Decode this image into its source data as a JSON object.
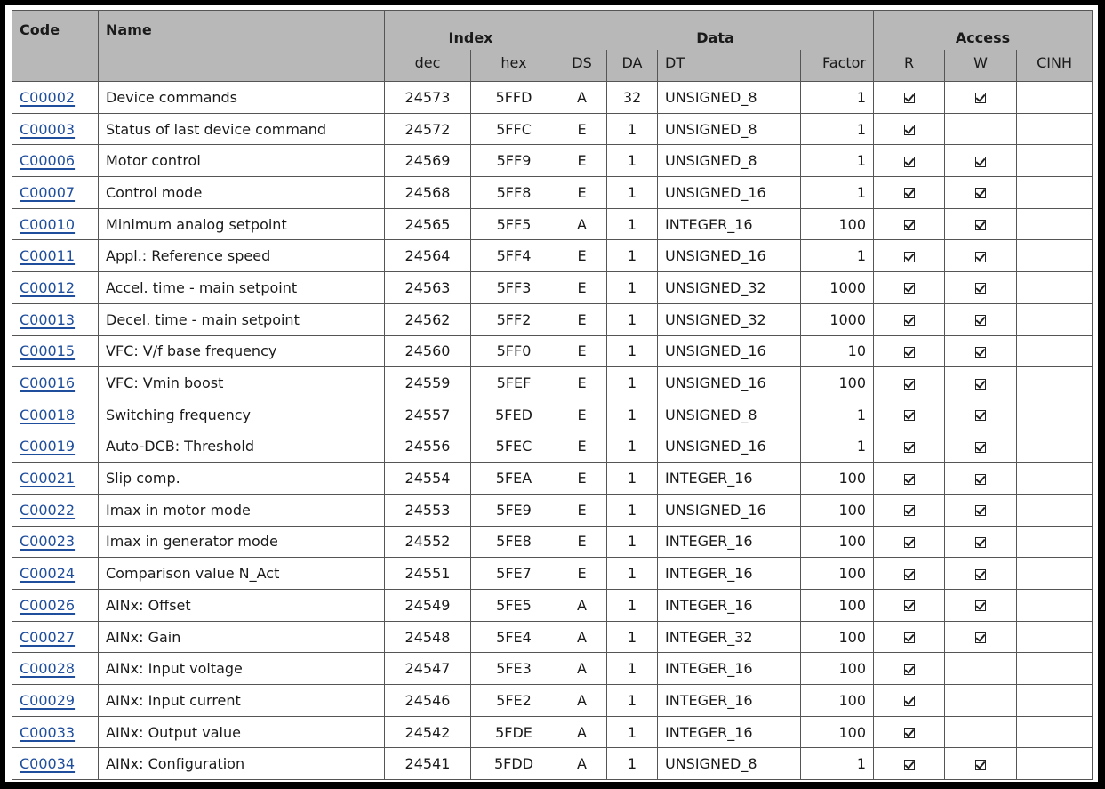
{
  "headers": {
    "code": "Code",
    "name": "Name",
    "index": "Index",
    "data": "Data",
    "access": "Access",
    "dec": "dec",
    "hex": "hex",
    "ds": "DS",
    "da": "DA",
    "dt": "DT",
    "factor": "Factor",
    "r": "R",
    "w": "W",
    "cinh": "CINH"
  },
  "icons": {
    "check": "checkbox-checked-icon"
  },
  "colors": {
    "header_bg": "#b8b8b8",
    "link": "#1f4e9c",
    "border": "#555555"
  },
  "rows": [
    {
      "code": "C00002",
      "name": "Device commands",
      "dec": "24573",
      "hex": "5FFD",
      "ds": "A",
      "da": "32",
      "dt": "UNSIGNED_8",
      "factor": "1",
      "r": true,
      "w": true,
      "cinh": false
    },
    {
      "code": "C00003",
      "name": "Status of last device command",
      "dec": "24572",
      "hex": "5FFC",
      "ds": "E",
      "da": "1",
      "dt": "UNSIGNED_8",
      "factor": "1",
      "r": true,
      "w": false,
      "cinh": false
    },
    {
      "code": "C00006",
      "name": "Motor control",
      "dec": "24569",
      "hex": "5FF9",
      "ds": "E",
      "da": "1",
      "dt": "UNSIGNED_8",
      "factor": "1",
      "r": true,
      "w": true,
      "cinh": false
    },
    {
      "code": "C00007",
      "name": "Control mode",
      "dec": "24568",
      "hex": "5FF8",
      "ds": "E",
      "da": "1",
      "dt": "UNSIGNED_16",
      "factor": "1",
      "r": true,
      "w": true,
      "cinh": false
    },
    {
      "code": "C00010",
      "name": "Minimum analog setpoint",
      "dec": "24565",
      "hex": "5FF5",
      "ds": "A",
      "da": "1",
      "dt": "INTEGER_16",
      "factor": "100",
      "r": true,
      "w": true,
      "cinh": false
    },
    {
      "code": "C00011",
      "name": "Appl.: Reference speed",
      "dec": "24564",
      "hex": "5FF4",
      "ds": "E",
      "da": "1",
      "dt": "UNSIGNED_16",
      "factor": "1",
      "r": true,
      "w": true,
      "cinh": false
    },
    {
      "code": "C00012",
      "name": "Accel. time - main setpoint",
      "dec": "24563",
      "hex": "5FF3",
      "ds": "E",
      "da": "1",
      "dt": "UNSIGNED_32",
      "factor": "1000",
      "r": true,
      "w": true,
      "cinh": false
    },
    {
      "code": "C00013",
      "name": "Decel. time - main setpoint",
      "dec": "24562",
      "hex": "5FF2",
      "ds": "E",
      "da": "1",
      "dt": "UNSIGNED_32",
      "factor": "1000",
      "r": true,
      "w": true,
      "cinh": false
    },
    {
      "code": "C00015",
      "name": "VFC: V/f base frequency",
      "dec": "24560",
      "hex": "5FF0",
      "ds": "E",
      "da": "1",
      "dt": "UNSIGNED_16",
      "factor": "10",
      "r": true,
      "w": true,
      "cinh": false
    },
    {
      "code": "C00016",
      "name": "VFC: Vmin boost",
      "dec": "24559",
      "hex": "5FEF",
      "ds": "E",
      "da": "1",
      "dt": "UNSIGNED_16",
      "factor": "100",
      "r": true,
      "w": true,
      "cinh": false
    },
    {
      "code": "C00018",
      "name": "Switching frequency",
      "dec": "24557",
      "hex": "5FED",
      "ds": "E",
      "da": "1",
      "dt": "UNSIGNED_8",
      "factor": "1",
      "r": true,
      "w": true,
      "cinh": false
    },
    {
      "code": "C00019",
      "name": "Auto-DCB: Threshold",
      "dec": "24556",
      "hex": "5FEC",
      "ds": "E",
      "da": "1",
      "dt": "UNSIGNED_16",
      "factor": "1",
      "r": true,
      "w": true,
      "cinh": false
    },
    {
      "code": "C00021",
      "name": "Slip comp.",
      "dec": "24554",
      "hex": "5FEA",
      "ds": "E",
      "da": "1",
      "dt": "INTEGER_16",
      "factor": "100",
      "r": true,
      "w": true,
      "cinh": false
    },
    {
      "code": "C00022",
      "name": "Imax in motor mode",
      "dec": "24553",
      "hex": "5FE9",
      "ds": "E",
      "da": "1",
      "dt": "UNSIGNED_16",
      "factor": "100",
      "r": true,
      "w": true,
      "cinh": false
    },
    {
      "code": "C00023",
      "name": "Imax in generator mode",
      "dec": "24552",
      "hex": "5FE8",
      "ds": "E",
      "da": "1",
      "dt": "INTEGER_16",
      "factor": "100",
      "r": true,
      "w": true,
      "cinh": false
    },
    {
      "code": "C00024",
      "name": "Comparison value N_Act",
      "dec": "24551",
      "hex": "5FE7",
      "ds": "E",
      "da": "1",
      "dt": "INTEGER_16",
      "factor": "100",
      "r": true,
      "w": true,
      "cinh": false
    },
    {
      "code": "C00026",
      "name": "AINx: Offset",
      "dec": "24549",
      "hex": "5FE5",
      "ds": "A",
      "da": "1",
      "dt": "INTEGER_16",
      "factor": "100",
      "r": true,
      "w": true,
      "cinh": false
    },
    {
      "code": "C00027",
      "name": "AINx: Gain",
      "dec": "24548",
      "hex": "5FE4",
      "ds": "A",
      "da": "1",
      "dt": "INTEGER_32",
      "factor": "100",
      "r": true,
      "w": true,
      "cinh": false
    },
    {
      "code": "C00028",
      "name": "AINx: Input voltage",
      "dec": "24547",
      "hex": "5FE3",
      "ds": "A",
      "da": "1",
      "dt": "INTEGER_16",
      "factor": "100",
      "r": true,
      "w": false,
      "cinh": false
    },
    {
      "code": "C00029",
      "name": "AINx: Input current",
      "dec": "24546",
      "hex": "5FE2",
      "ds": "A",
      "da": "1",
      "dt": "INTEGER_16",
      "factor": "100",
      "r": true,
      "w": false,
      "cinh": false
    },
    {
      "code": "C00033",
      "name": "AINx: Output value",
      "dec": "24542",
      "hex": "5FDE",
      "ds": "A",
      "da": "1",
      "dt": "INTEGER_16",
      "factor": "100",
      "r": true,
      "w": false,
      "cinh": false
    },
    {
      "code": "C00034",
      "name": "AINx: Configuration",
      "dec": "24541",
      "hex": "5FDD",
      "ds": "A",
      "da": "1",
      "dt": "UNSIGNED_8",
      "factor": "1",
      "r": true,
      "w": true,
      "cinh": false
    }
  ]
}
